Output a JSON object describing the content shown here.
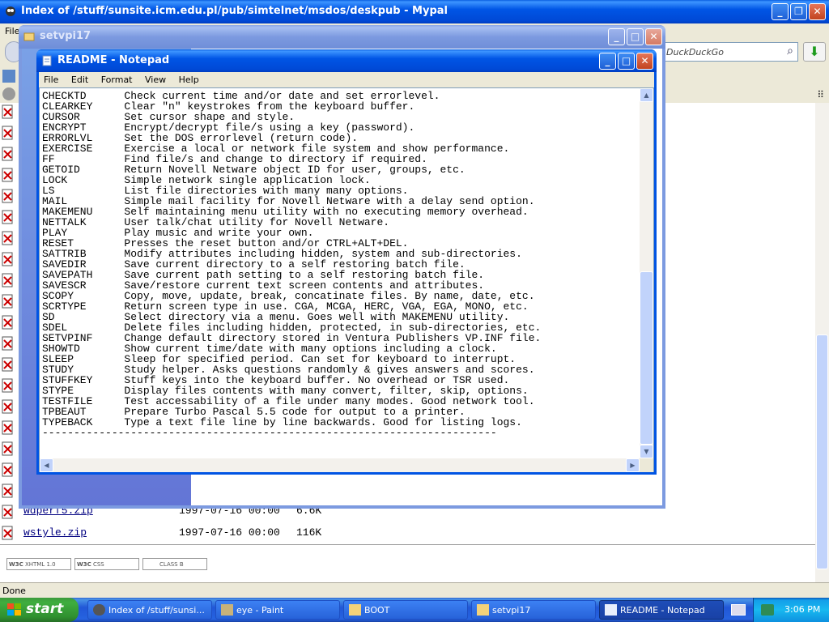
{
  "browser": {
    "title": "Index of /stuff/sunsite.icm.edu.pl/pub/simtelnet/msdos/deskpub - Mypal",
    "menu_file": "File",
    "search_placeholder": "DuckDuckGo",
    "status": "Done",
    "files": [
      {
        "name": "wdperf5.zip",
        "date": "1997-07-16 00:00",
        "size": "6.6K"
      },
      {
        "name": "wstyle.zip",
        "date": "1997-07-16 00:00",
        "size": "116K"
      }
    ],
    "badges": [
      "XHTML 1.0",
      "CSS",
      "CLASS B"
    ],
    "badge_prefix": "W3C"
  },
  "explorer": {
    "title": "setvpi17"
  },
  "notepad": {
    "title": "README - Notepad",
    "menu": [
      "File",
      "Edit",
      "Format",
      "View",
      "Help"
    ],
    "lines": [
      "CHECKTD      Check current time and/or date and set errorlevel.",
      "CLEARKEY     Clear \"n\" keystrokes from the keyboard buffer.",
      "CURSOR       Set cursor shape and style.",
      "ENCRYPT      Encrypt/decrypt file/s using a key (password).",
      "ERRORLVL     Set the DOS errorlevel (return code).",
      "EXERCISE     Exercise a local or network file system and show performance.",
      "FF           Find file/s and change to directory if required.",
      "GETOID       Return Novell Netware object ID for user, groups, etc.",
      "LOCK         Simple network single application lock.",
      "LS           List file directories with many many options.",
      "MAIL         Simple mail facility for Novell Netware with a delay send option.",
      "MAKEMENU     Self maintaining menu utility with no executing memory overhead.",
      "NETTALK      User talk/chat utility for Novell Netware.",
      "PLAY         Play music and write your own.",
      "RESET        Presses the reset button and/or CTRL+ALT+DEL.",
      "SATTRIB      Modify attributes including hidden, system and sub-directories.",
      "SAVEDIR      Save current directory to a self restoring batch file.",
      "SAVEPATH     Save current path setting to a self restoring batch file.",
      "SAVESCR      Save/restore current text screen contents and attributes.",
      "SCOPY        Copy, move, update, break, concatinate files. By name, date, etc.",
      "SCRTYPE      Return screen type in use. CGA, MCGA, HERC, VGA, EGA, MONO, etc.",
      "SD           Select directory via a menu. Goes well with MAKEMENU utility.",
      "SDEL         Delete files including hidden, protected, in sub-directories, etc.",
      "SETVPINF     Change default directory stored in Ventura Publishers VP.INF file.",
      "SHOWTD       Show current time/date with many options including a clock.",
      "SLEEP        Sleep for specified period. Can set for keyboard to interrupt.",
      "STUDY        Study helper. Asks questions randomly & gives answers and scores.",
      "STUFFKEY     Stuff keys into the keyboard buffer. No overhead or TSR used.",
      "STYPE        Display files contents with many convert, filter, skip, options.",
      "TESTFILE     Test accessability of a file under many modes. Good network tool.",
      "TPBEAUT      Prepare Turbo Pascal 5.5 code for output to a printer.",
      "TYPEBACK     Type a text file line by line backwards. Good for listing logs.",
      "------------------------------------------------------------------------"
    ]
  },
  "taskbar": {
    "start": "start",
    "tasks": [
      {
        "label": "Index of /stuff/sunsi...",
        "icon": "mypal-icon"
      },
      {
        "label": "eye - Paint",
        "icon": "paint-icon"
      },
      {
        "label": "BOOT",
        "icon": "folder-icon"
      },
      {
        "label": "setvpi17",
        "icon": "folder-icon"
      },
      {
        "label": "README - Notepad",
        "icon": "notepad-icon"
      }
    ],
    "clock": "3:06 PM"
  },
  "colors": {
    "xp_blue": "#0055e5",
    "start_green": "#3c9a3c",
    "link": "#000080"
  }
}
